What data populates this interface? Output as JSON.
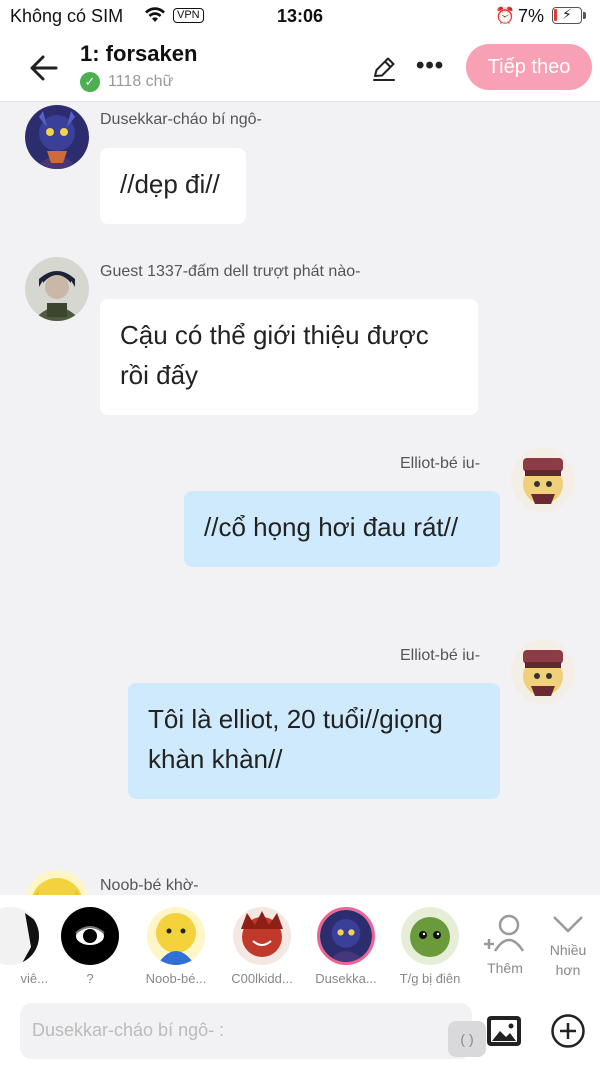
{
  "status": {
    "carrier": "Không có SIM",
    "vpn": "VPN",
    "time": "13:06",
    "battery": "7%"
  },
  "header": {
    "title": "1: forsaken",
    "word_count": "1118 chữ",
    "next_label": "Tiếp theo"
  },
  "messages": [
    {
      "side": "left",
      "name": "Dusekkar-cháo bí ngô-",
      "text": "//dẹp đi//"
    },
    {
      "side": "left",
      "name": "Guest 1337-đấm dell trượt phát nào-",
      "text": "Cậu có thể giới thiệu được rồi đấy"
    },
    {
      "side": "right",
      "name": "Elliot-bé iu-",
      "text": "//cổ họng hơi đau rát//"
    },
    {
      "side": "right",
      "name": "Elliot-bé iu-",
      "text": "Tôi là elliot, 20 tuổi//giọng khàn khàn//"
    },
    {
      "side": "left",
      "name": "Noob-bé khờ-",
      "text": ""
    }
  ],
  "characters": [
    {
      "label": "viê..."
    },
    {
      "label": "?"
    },
    {
      "label": "Noob-bé..."
    },
    {
      "label": "C00lkidd..."
    },
    {
      "label": "Dusekka..."
    },
    {
      "label": "T/g bị điên"
    }
  ],
  "char_actions": {
    "add_label": "Thêm",
    "more_label": "Nhiều hơn"
  },
  "input": {
    "placeholder": "Dusekkar-cháo bí ngô- :",
    "paren": "( )"
  },
  "colors": {
    "accent": "#f8a1b5",
    "right_bubble": "#cfeafc",
    "selected_ring": "#f06292"
  }
}
